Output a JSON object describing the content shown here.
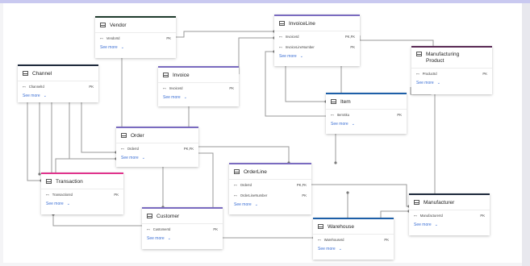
{
  "see_more_label": "See more",
  "chevron_glyph": "⌄",
  "key_glyph": "⊷",
  "tables": {
    "vendor": {
      "title": "Vendor",
      "color": "#1f3b2d",
      "rows": [
        {
          "name": "VendorId",
          "key": "PK"
        }
      ]
    },
    "invoiceline": {
      "title": "InvoiceLine",
      "color": "#7a6bc0",
      "rows": [
        {
          "name": "InvoiceId",
          "key": "PK,FK"
        },
        {
          "name": "InvoiceLineNumber",
          "key": "PK"
        }
      ]
    },
    "manufacturing_product": {
      "title_line1": "Manufacturing",
      "title_line2": "Product",
      "color": "#5a2a55",
      "rows": [
        {
          "name": "ProductId",
          "key": "PK"
        }
      ]
    },
    "channel": {
      "title": "Channel",
      "color": "#1f2b3d",
      "rows": [
        {
          "name": "ChannelId",
          "key": "PK"
        }
      ]
    },
    "invoice": {
      "title": "Invoice",
      "color": "#7a6bc0",
      "rows": [
        {
          "name": "InvoiceId",
          "key": "PK"
        }
      ]
    },
    "item": {
      "title": "Item",
      "color": "#1d5fa8",
      "rows": [
        {
          "name": "ItemSku",
          "key": "PK"
        }
      ]
    },
    "order": {
      "title": "Order",
      "color": "#7a6bc0",
      "rows": [
        {
          "name": "OrderId",
          "key": "PK,FK"
        }
      ]
    },
    "orderline": {
      "title": "OrderLine",
      "color": "#7a6bc0",
      "rows": [
        {
          "name": "OrderId",
          "key": "PK,FK"
        },
        {
          "name": "OrderLineNumber",
          "key": "PK"
        }
      ]
    },
    "transaction": {
      "title": "Transaction",
      "color": "#e0338c",
      "rows": [
        {
          "name": "TransactionId",
          "key": "PK"
        }
      ]
    },
    "manufacturer": {
      "title": "Manufacturer",
      "color": "#1f2b3d",
      "rows": [
        {
          "name": "ManufacturerId",
          "key": "PK"
        }
      ]
    },
    "customer": {
      "title": "Customer",
      "color": "#7a6bc0",
      "rows": [
        {
          "name": "CustomerId",
          "key": "PK"
        }
      ]
    },
    "warehouse": {
      "title": "Warehouse",
      "color": "#1d5fa8",
      "rows": [
        {
          "name": "WarehouseId",
          "key": "PK"
        }
      ]
    }
  }
}
